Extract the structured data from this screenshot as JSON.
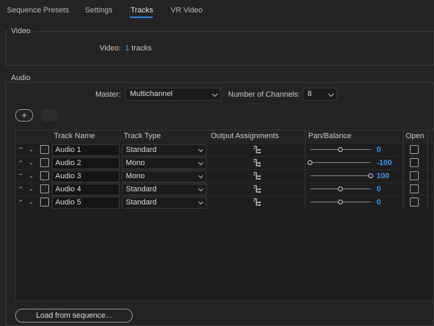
{
  "tabs": [
    {
      "label": "Sequence Presets"
    },
    {
      "label": "Settings"
    },
    {
      "label": "Tracks"
    },
    {
      "label": "VR Video"
    }
  ],
  "active_tab": "Tracks",
  "colors": {
    "accent": "#2d8ceb",
    "value_blue": "#3a9bef",
    "background": "#232323"
  },
  "video": {
    "legend": "Video",
    "label": "Video:",
    "count": "1",
    "unit": "tracks"
  },
  "audio": {
    "legend": "Audio",
    "master_label": "Master:",
    "master_value": "Multichannel",
    "channels_label": "Number of Channels:",
    "channels_value": "8",
    "add_label": "+",
    "remove_label": "-"
  },
  "table": {
    "headers": {
      "name": "Track Name",
      "type": "Track Type",
      "output": "Output Assignments",
      "pan": "Pan/Balance",
      "open": "Open"
    },
    "rows": [
      {
        "name": "Audio 1",
        "type": "Standard",
        "pan": "0",
        "pan_level": 0.5,
        "open": false
      },
      {
        "name": "Audio 2",
        "type": "Mono",
        "pan": "-100",
        "pan_level": 0.0,
        "open": false
      },
      {
        "name": "Audio 3",
        "type": "Mono",
        "pan": "100",
        "pan_level": 1.0,
        "open": false
      },
      {
        "name": "Audio 4",
        "type": "Standard",
        "pan": "0",
        "pan_level": 0.5,
        "open": false
      },
      {
        "name": "Audio 5",
        "type": "Standard",
        "pan": "0",
        "pan_level": 0.5,
        "open": false
      }
    ]
  },
  "load_button": "Load from sequence..."
}
